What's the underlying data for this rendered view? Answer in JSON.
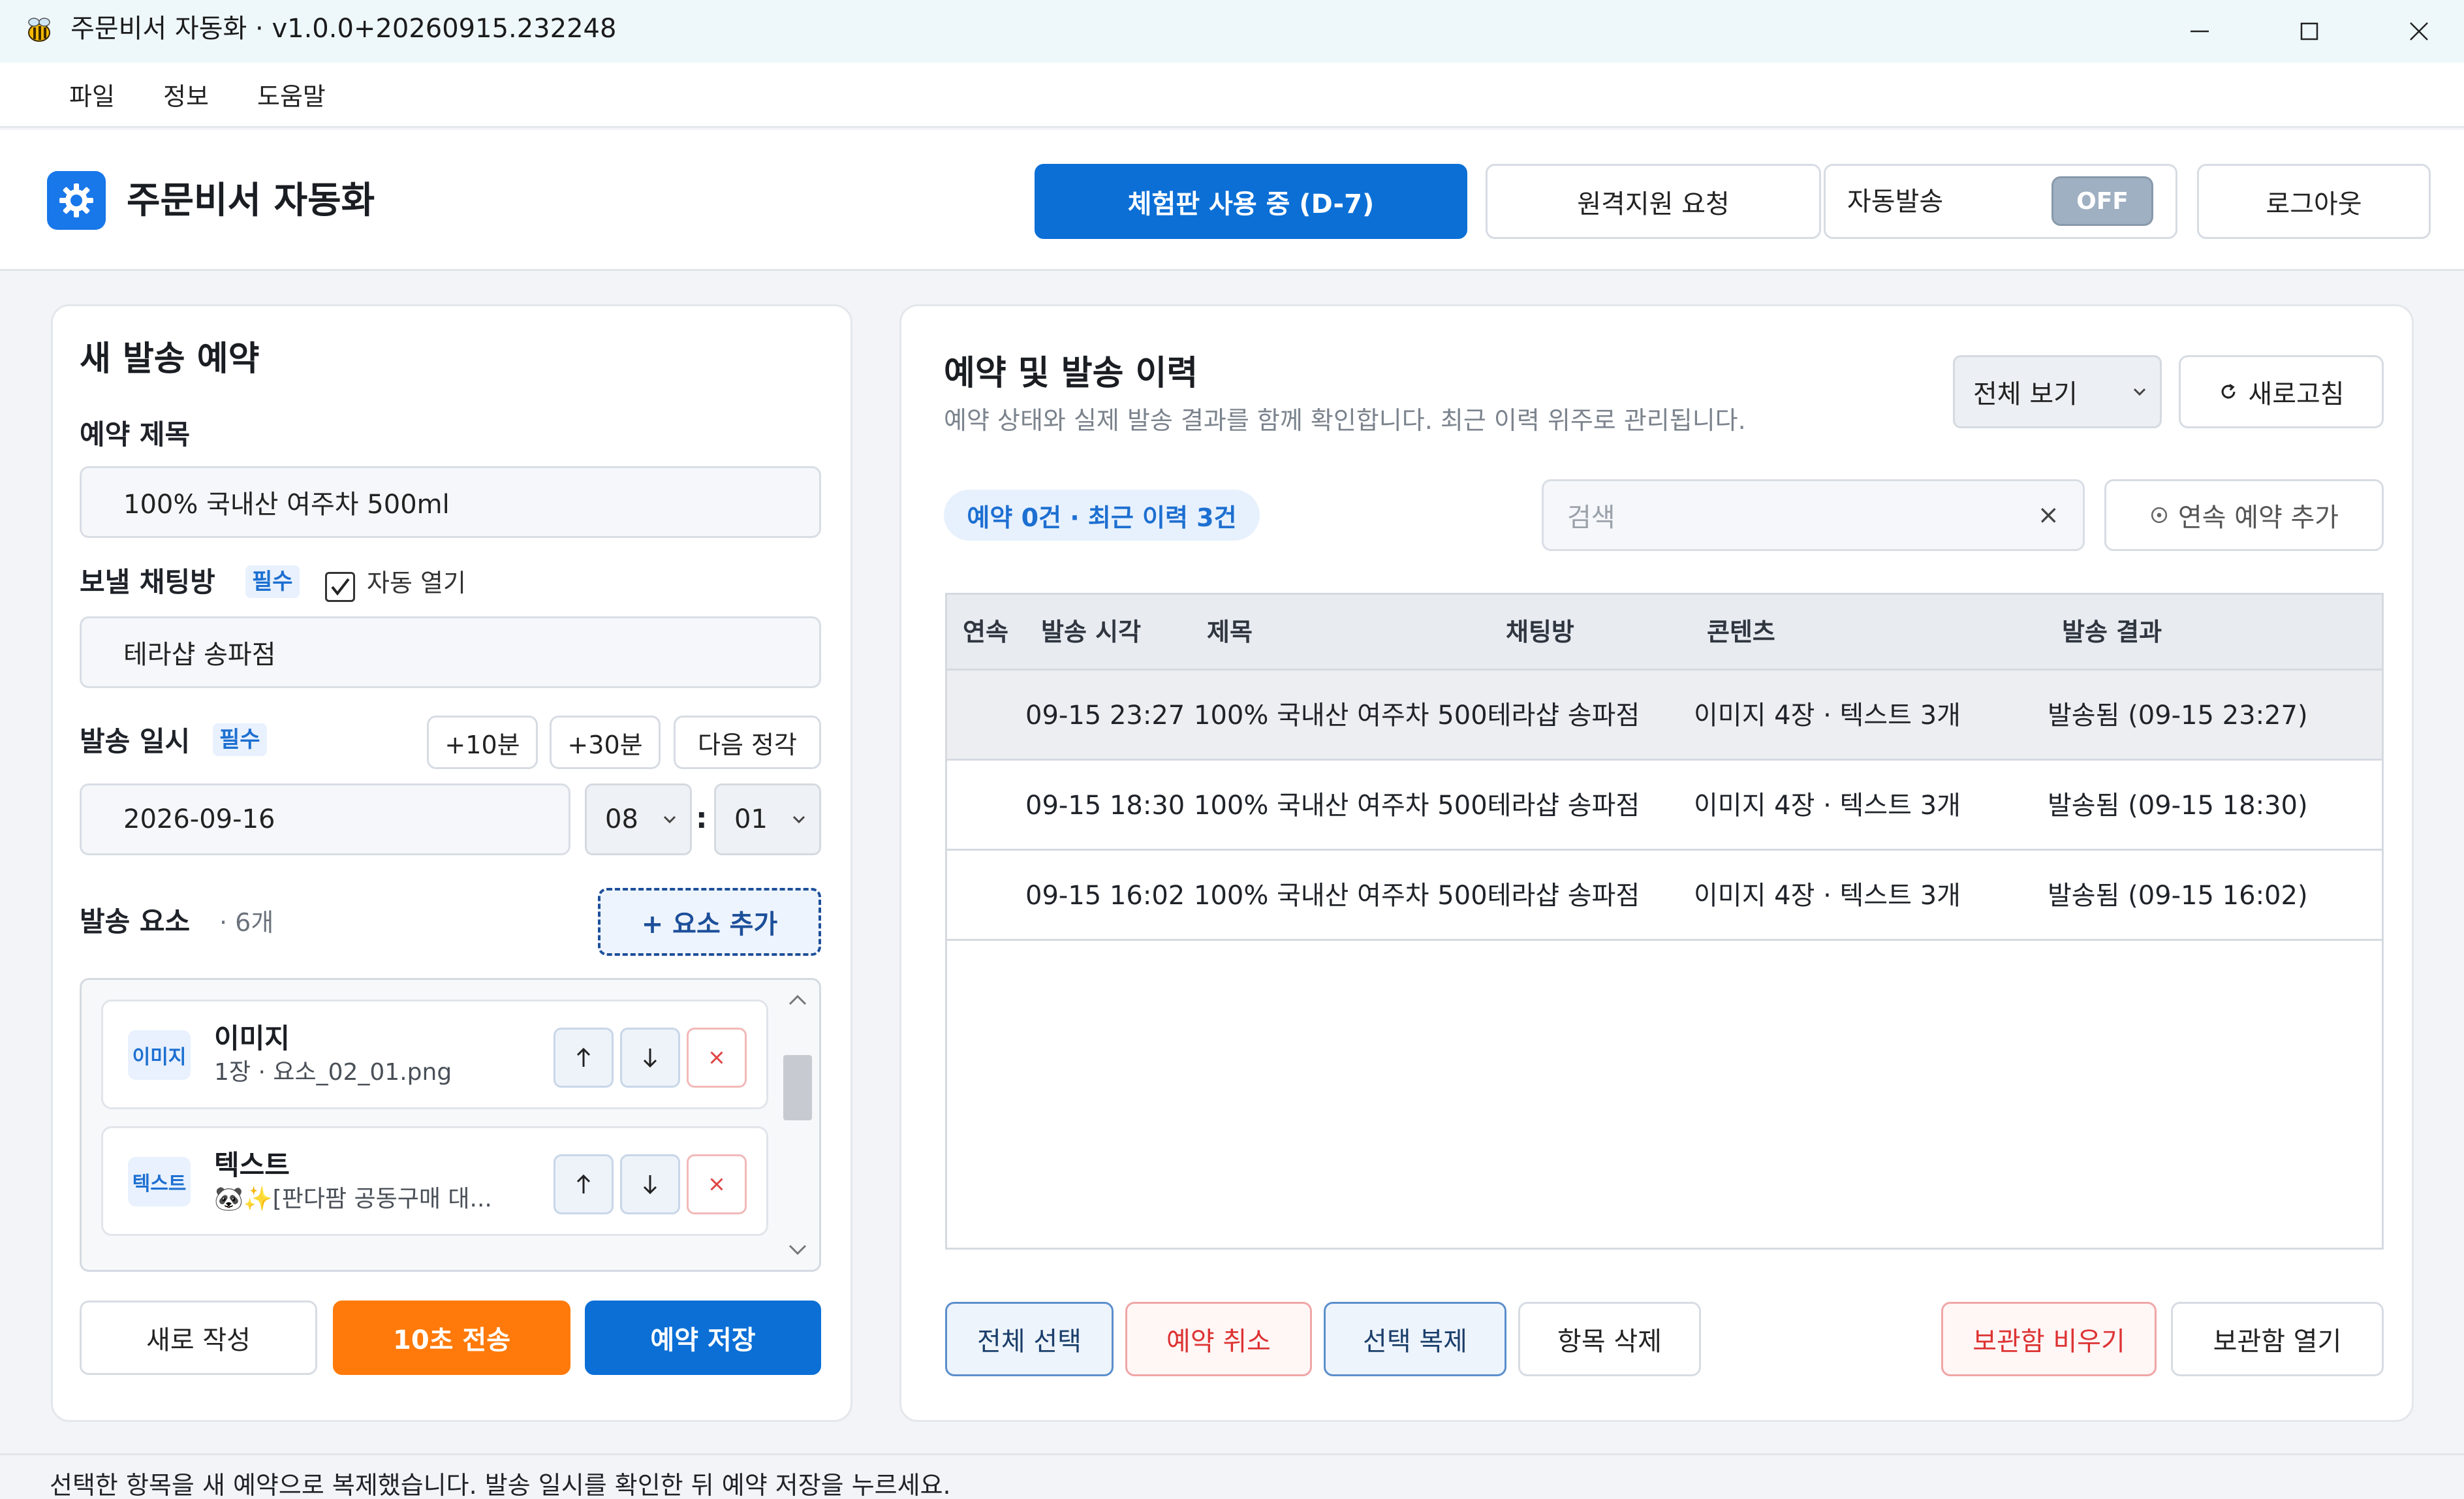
{
  "window": {
    "title": "주문비서 자동화 · v1.0.0+20260915.232248"
  },
  "menu": [
    "파일",
    "정보",
    "도움말"
  ],
  "header": {
    "title": "주문비서 자동화",
    "trial_label": "체험판 사용 중 (D-7)",
    "remote_label": "원격지원 요청",
    "auto_send_label": "자동발송",
    "auto_send_state": "OFF",
    "logout_label": "로그아웃"
  },
  "form": {
    "heading": "새 발송 예약",
    "title_label": "예약 제목",
    "title_value": "100% 국내산 여주차 500ml",
    "chat_label": "보낼 채팅방",
    "required": "필수",
    "auto_open_label": "자동 열기",
    "auto_open_checked": true,
    "chat_value": "테라샵 송파점",
    "datetime_label": "발송 일시",
    "plus10": "+10분",
    "plus30": "+30분",
    "next_hour": "다음 정각",
    "date_value": "2026-09-16",
    "hour_value": "08",
    "minute_value": "01",
    "time_sep": ":",
    "elements_label": "발송 요소",
    "elements_count": "· 6개",
    "add_element": "+ 요소 추가",
    "elements": [
      {
        "badge": "이미지",
        "title": "이미지",
        "sub": "1장 · 요소_02_01.png"
      },
      {
        "badge": "텍스트",
        "title": "텍스트",
        "sub": "🐼✨[판다팜 공동구매 대..."
      }
    ],
    "new_label": "새로 작성",
    "send10_label": "10초 전송",
    "save_label": "예약 저장"
  },
  "history": {
    "heading": "예약 및 발송 이력",
    "subtitle": "예약 상태와 실제 발송 결과를 함께 확인합니다. 최근 이력 위주로 관리됩니다.",
    "filter_value": "전체 보기",
    "refresh_label": "새로고침",
    "summary": "예약 0건 · 최근 이력 3건",
    "search_placeholder": "검색",
    "search_clear": "×",
    "add_series_label": "연속 예약 추가",
    "columns": [
      "연속",
      "발송 시각",
      "제목",
      "채팅방",
      "콘텐츠",
      "발송 결과"
    ],
    "rows": [
      {
        "series": "",
        "time": "09-15 23:27",
        "title_room": "100% 국내산 여주차 500테라샵 송파점",
        "content": "이미지 4장 · 텍스트 3개",
        "result": "발송됨 (09-15 23:27)"
      },
      {
        "series": "",
        "time": "09-15 18:30",
        "title_room": "100% 국내산 여주차 500테라샵 송파점",
        "content": "이미지 4장 · 텍스트 3개",
        "result": "발송됨 (09-15 18:30)"
      },
      {
        "series": "",
        "time": "09-15 16:02",
        "title_room": "100% 국내산 여주차 500테라샵 송파점",
        "content": "이미지 4장 · 텍스트 3개",
        "result": "발송됨 (09-15 16:02)"
      }
    ],
    "select_all": "전체 선택",
    "cancel_reservation": "예약 취소",
    "duplicate": "선택 복제",
    "delete_item": "항목 삭제",
    "empty_archive": "보관함 비우기",
    "open_archive": "보관함 열기"
  },
  "status": {
    "message": "선택한 항목을 새 예약으로 복제했습니다. 발송 일시를 확인한 뒤 예약 저장을 누르세요."
  },
  "colors": {
    "primary": "#0b6fd6",
    "orange": "#ff7a0a",
    "danger": "#d33333"
  }
}
